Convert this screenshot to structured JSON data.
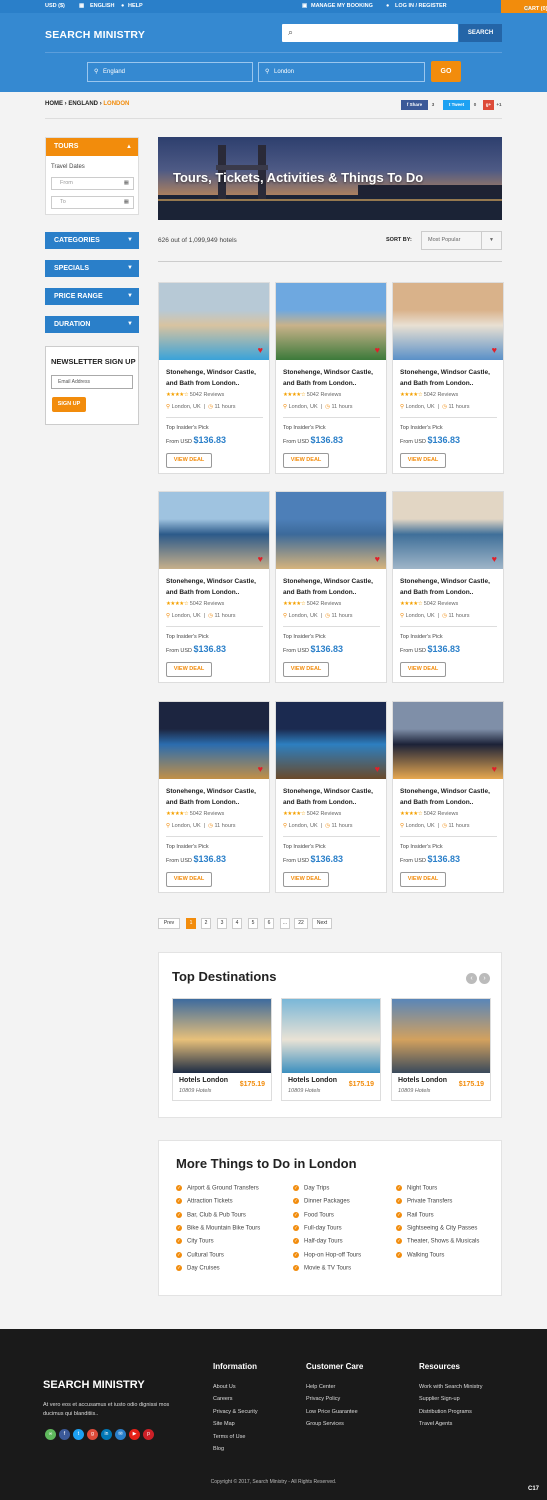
{
  "topbar": {
    "currency": "USD ($)",
    "language": "ENGLISH",
    "help": "HELP",
    "manage": "MANAGE MY BOOKING",
    "login": "LOG IN / REGISTER",
    "cart": "CART (0)"
  },
  "header": {
    "logo": "SEARCH MINISTRY",
    "search_button": "SEARCH",
    "country": "England",
    "city": "London",
    "go": "GO"
  },
  "breadcrumb": {
    "home": "HOME",
    "sep": "›",
    "country": "ENGLAND",
    "city": "LONDON"
  },
  "share": {
    "facebook": "Share",
    "facebook_count": "3",
    "tweet": "Tweet",
    "tweet_count": "0",
    "gplus_count": "+1"
  },
  "sidebar": {
    "tours": "TOURS",
    "travel_dates": "Travel Dates",
    "from_placeholder": "From",
    "to_placeholder": "To",
    "categories": "CATEGORIES",
    "specials": "SPECIALS",
    "price_range": "PRICE RANGE",
    "duration": "DURATION",
    "newsletter_title": "NEWSLETTER SIGN UP",
    "email_placeholder": "Email Address",
    "signup": "SIGN UP"
  },
  "banner": {
    "title": "Tours, Tickets, Activities & Things To Do"
  },
  "results": {
    "count": "626 out of 1,099,949 hotels",
    "sort_label": "SORT BY:",
    "sort_value": "Most Popular"
  },
  "card": {
    "title": "Stonehenge, Windsor Castle, and Bath from London..",
    "stars": "★★★★☆",
    "reviews": "5042 Reviews",
    "location": "London, UK",
    "duration": "11 hours",
    "pick": "Top Insider's Pick",
    "from": "From USD",
    "price": "$136.83",
    "deal": "VIEW DEAL"
  },
  "pagination": {
    "prev": "Prev",
    "p1": "1",
    "p2": "2",
    "p3": "3",
    "p4": "4",
    "p5": "5",
    "p6": "6",
    "dots": "...",
    "p22": "22",
    "next": "Next"
  },
  "top_destinations": {
    "title": "Top Destinations",
    "name": "Hotels London",
    "hotels": "10809 Hotels",
    "price": "$175.19"
  },
  "things": {
    "title": "More Things to Do in London",
    "col1": [
      "Airport & Ground Transfers",
      "Attraction Tickets",
      "Bar, Club & Pub Tours",
      "Bike & Mountain Bike Tours",
      "City Tours",
      "Cultural Tours",
      "Day Cruises"
    ],
    "col2": [
      "Day Trips",
      "Dinner Packages",
      "Food Tours",
      "Full-day Tours",
      "Half-day Tours",
      "Hop-on Hop-off Tours",
      "Movie & TV Tours"
    ],
    "col3": [
      "Night Tours",
      "Private Transfers",
      "Rail Tours",
      "Sightseeing & City Passes",
      "Theater, Shows & Musicals",
      "Walking Tours"
    ]
  },
  "footer": {
    "logo": "SEARCH MINISTRY",
    "desc": "At vero eos et accusamus et iusto odio dignissi mos ducimus qui blanditiis..",
    "information": "Information",
    "info_links": [
      "About Us",
      "Careers",
      "Privacy & Security",
      "Site Map",
      "Terms of Use",
      "Blog"
    ],
    "customer_care": "Customer Care",
    "care_links": [
      "Help Center",
      "Privacy Policy",
      "Low Price Guarantee",
      "Group Services"
    ],
    "resources": "Resources",
    "res_links": [
      "Work with Search Ministry",
      "Supplier Sign-up",
      "Distribution Programs",
      "Travel Agents"
    ],
    "copyright": "Copyright © 2017, Search Ministry - All Rights Reserved.",
    "page_code": "C17"
  },
  "colors": {
    "primary": "#2a7fc9",
    "accent": "#f28c0c",
    "dark": "#1a1a1a"
  }
}
